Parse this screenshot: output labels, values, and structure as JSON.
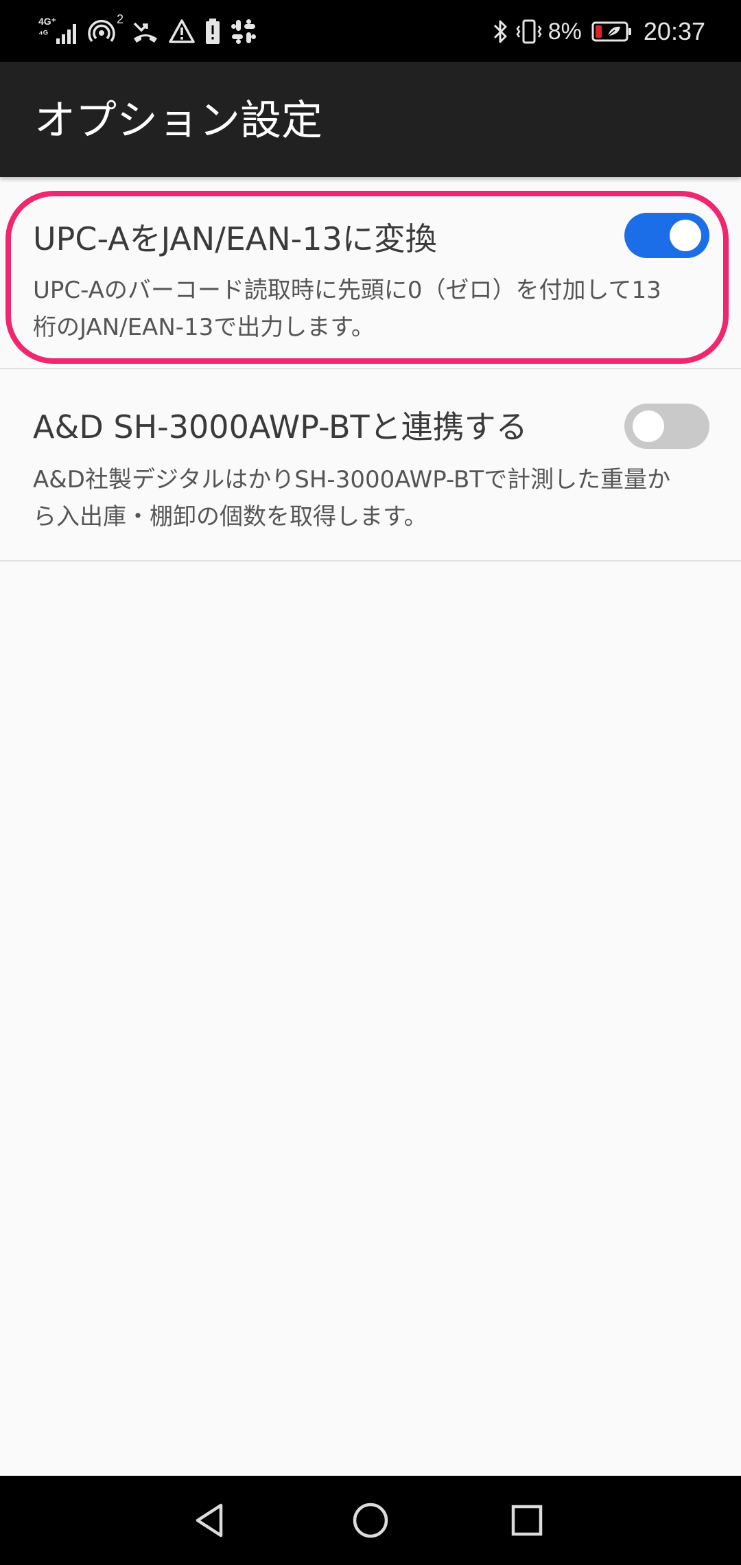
{
  "status_bar": {
    "network_top": "4G⁺",
    "network_bottom": "⁴ᴳ",
    "hotspot_count": "2",
    "battery_percent": "8%",
    "time": "20:37"
  },
  "app_bar": {
    "title": "オプション設定"
  },
  "preferences": [
    {
      "title": "UPC-AをJAN/EAN-13に変換",
      "summary_line1": "UPC-Aのバーコード読取時に先頭に0（ゼロ）を付加して13",
      "summary_line2": "桁のJAN/EAN-13で出力します。",
      "enabled": true
    },
    {
      "title": "A&D SH-3000AWP-BTと連携する",
      "summary_line1": "A&D社製デジタルはかりSH-3000AWP-BTで計測した重量か",
      "summary_line2": "ら入出庫・棚卸の個数を取得します。",
      "enabled": false
    }
  ],
  "colors": {
    "switch_on": "#1c6ee8",
    "switch_off": "#c9c9c9",
    "highlight": "#f0266e",
    "app_bar": "#212121"
  },
  "icons": {
    "status_left": [
      "signal-icon",
      "hotspot-icon",
      "missed-call-icon",
      "warning-icon",
      "battery-saver-icon",
      "slack-icon"
    ],
    "status_right": [
      "bluetooth-icon",
      "vibrate-icon",
      "battery-icon"
    ],
    "nav": [
      "back-icon",
      "home-icon",
      "recents-icon"
    ]
  }
}
